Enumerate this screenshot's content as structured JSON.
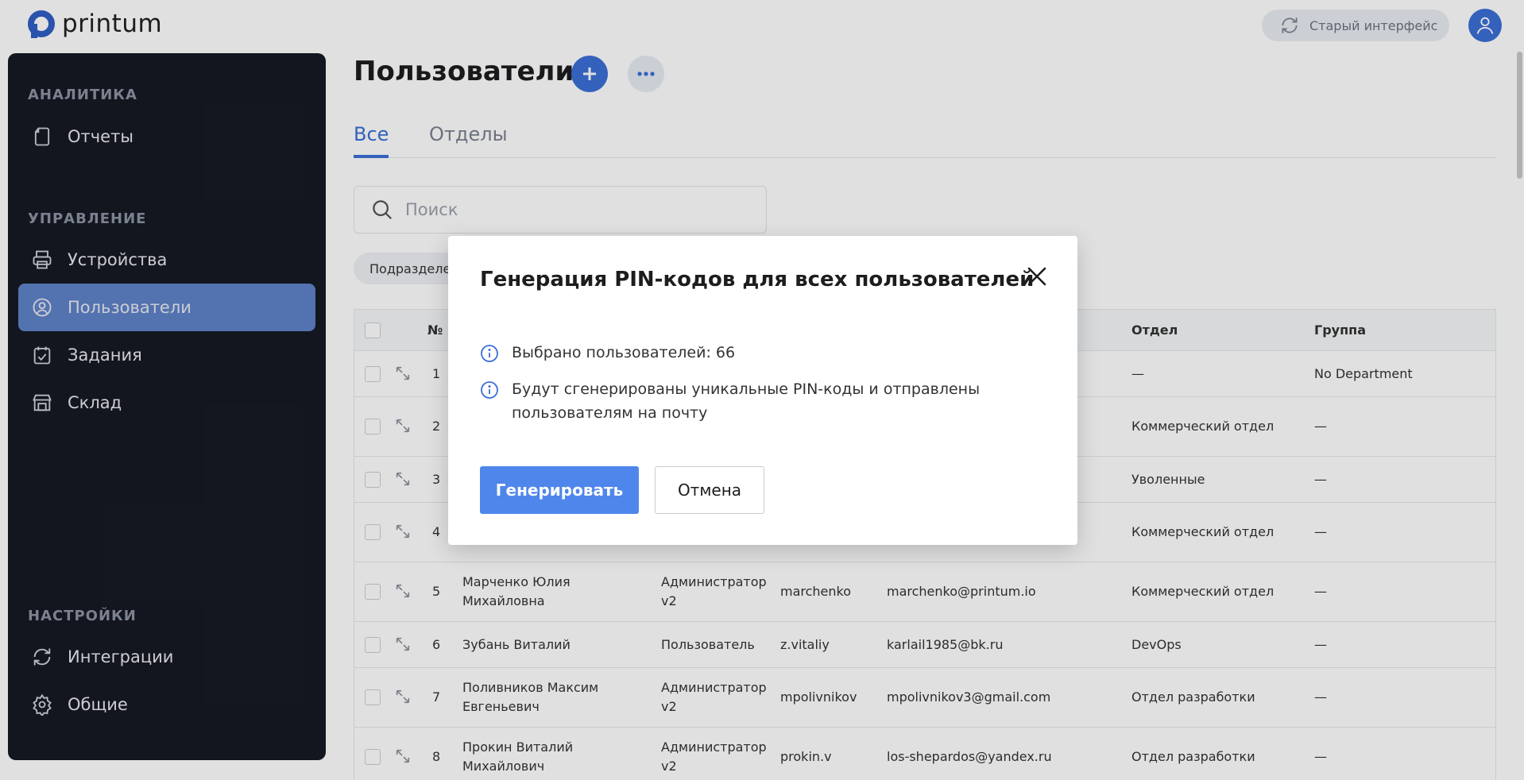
{
  "brand": {
    "name": "printum",
    "accent": "#3b6fd6"
  },
  "header": {
    "old_ui_label": "Старый интерфейс"
  },
  "sidebar": {
    "sections": [
      {
        "title": "АНАЛИТИКА"
      },
      {
        "title": "УПРАВЛЕНИЕ"
      },
      {
        "title": "НАСТРОЙКИ"
      }
    ],
    "items": [
      {
        "label": "Отчеты",
        "icon": "file-icon"
      },
      {
        "label": "Устройства",
        "icon": "printer-icon"
      },
      {
        "label": "Пользователи",
        "icon": "user-circle-icon",
        "active": true
      },
      {
        "label": "Задания",
        "icon": "task-icon"
      },
      {
        "label": "Склад",
        "icon": "store-icon"
      },
      {
        "label": "Интеграции",
        "icon": "sync-icon"
      },
      {
        "label": "Общие",
        "icon": "gear-icon"
      }
    ]
  },
  "main": {
    "title": "Пользователи",
    "tabs": [
      {
        "label": "Все",
        "active": true
      },
      {
        "label": "Отделы"
      }
    ],
    "search_placeholder": "Поиск",
    "filter_label": "Подразделе",
    "table": {
      "headers": {
        "num": "№",
        "dept": "Отдел",
        "group": "Группа"
      },
      "rows": [
        {
          "num": "1",
          "name": "",
          "role": "",
          "login": "",
          "email": "",
          "dept": "—",
          "group": "No Department"
        },
        {
          "num": "2",
          "name": "",
          "role": "",
          "login": "",
          "email": "",
          "dept": "Коммерческий отдел",
          "group": "—"
        },
        {
          "num": "3",
          "name": "",
          "role": "",
          "login": "",
          "email": "",
          "dept": "Уволенные",
          "group": "—"
        },
        {
          "num": "4",
          "name": "",
          "role": "",
          "login": "",
          "email": "",
          "dept": "Коммерческий отдел",
          "group": "—"
        },
        {
          "num": "5",
          "name": "Марченко Юлия Михайловна",
          "role": "Администратор v2",
          "login": "marchenko",
          "email": "marchenko@printum.io",
          "dept": "Коммерческий отдел",
          "group": "—"
        },
        {
          "num": "6",
          "name": "Зубань Виталий",
          "role": "Пользователь",
          "login": "z.vitaliy",
          "email": "karlail1985@bk.ru",
          "dept": "DevOps",
          "group": "—"
        },
        {
          "num": "7",
          "name": "Поливников Максим Евгеньевич",
          "role": "Администратор v2",
          "login": "mpolivnikov",
          "email": "mpolivnikov3@gmail.com",
          "dept": "Отдел разработки",
          "group": "—"
        },
        {
          "num": "8",
          "name": "Прокин Виталий Михайлович",
          "role": "Администратор v2",
          "login": "prokin.v",
          "email": "los-shepardos@yandex.ru",
          "dept": "Отдел разработки",
          "group": "—"
        }
      ]
    }
  },
  "modal": {
    "title": "Генерация PIN-кодов для всех пользователей",
    "selected_text": "Выбрано пользователей: 66",
    "info_text": "Будут сгенерированы уникальные PIN-коды и отправлены пользователям на почту",
    "primary_label": "Генерировать",
    "cancel_label": "Отмена"
  }
}
